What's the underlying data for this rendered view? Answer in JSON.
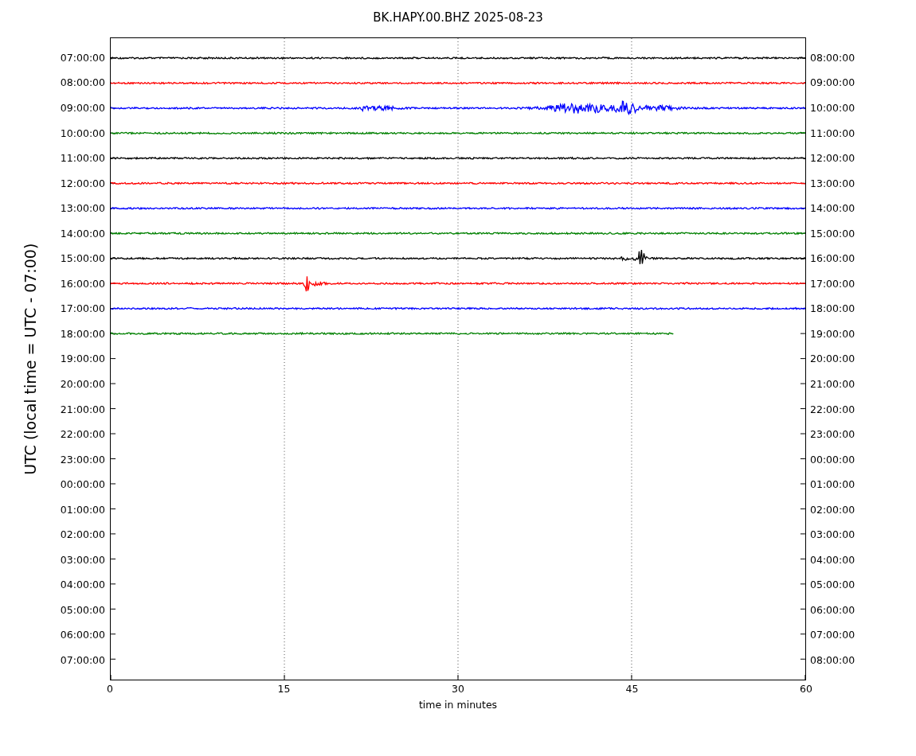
{
  "title": "BK.HAPY.00.BHZ 2025-08-23",
  "y_axis_label": "UTC (local time = UTC - 07:00)",
  "x_axis_label": "time in minutes",
  "x_ticks": [
    "0",
    "15",
    "30",
    "45",
    "60"
  ],
  "rows": [
    {
      "left": "07:00:00",
      "right": "08:00:00"
    },
    {
      "left": "08:00:00",
      "right": "09:00:00"
    },
    {
      "left": "09:00:00",
      "right": "10:00:00"
    },
    {
      "left": "10:00:00",
      "right": "11:00:00"
    },
    {
      "left": "11:00:00",
      "right": "12:00:00"
    },
    {
      "left": "12:00:00",
      "right": "13:00:00"
    },
    {
      "left": "13:00:00",
      "right": "14:00:00"
    },
    {
      "left": "14:00:00",
      "right": "15:00:00"
    },
    {
      "left": "15:00:00",
      "right": "16:00:00"
    },
    {
      "left": "16:00:00",
      "right": "17:00:00"
    },
    {
      "left": "17:00:00",
      "right": "18:00:00"
    },
    {
      "left": "18:00:00",
      "right": "19:00:00"
    },
    {
      "left": "19:00:00",
      "right": "20:00:00"
    },
    {
      "left": "20:00:00",
      "right": "21:00:00"
    },
    {
      "left": "21:00:00",
      "right": "22:00:00"
    },
    {
      "left": "22:00:00",
      "right": "23:00:00"
    },
    {
      "left": "23:00:00",
      "right": "00:00:00"
    },
    {
      "left": "00:00:00",
      "right": "01:00:00"
    },
    {
      "left": "01:00:00",
      "right": "02:00:00"
    },
    {
      "left": "02:00:00",
      "right": "03:00:00"
    },
    {
      "left": "03:00:00",
      "right": "04:00:00"
    },
    {
      "left": "04:00:00",
      "right": "05:00:00"
    },
    {
      "left": "05:00:00",
      "right": "06:00:00"
    },
    {
      "left": "06:00:00",
      "right": "07:00:00"
    },
    {
      "left": "07:00:00",
      "right": "08:00:00"
    }
  ],
  "traces": [
    {
      "color": "#000000",
      "level": 1
    },
    {
      "color": "#ff0000",
      "level": 1
    },
    {
      "color": "#0000ff",
      "level": 1
    },
    {
      "color": "#008000",
      "level": 1
    },
    {
      "color": "#000000",
      "level": 1
    },
    {
      "color": "#ff0000",
      "level": 1
    },
    {
      "color": "#0000ff",
      "level": 1
    },
    {
      "color": "#008000",
      "level": 1
    },
    {
      "color": "#000000",
      "level": 1
    },
    {
      "color": "#ff0000",
      "level": 1
    },
    {
      "color": "#0000ff",
      "level": 1
    },
    {
      "color": "#008000",
      "level": 0.81
    }
  ]
}
